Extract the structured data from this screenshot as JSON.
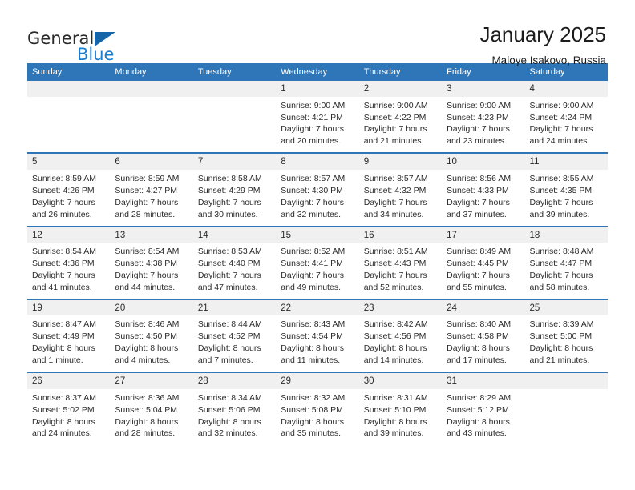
{
  "logo": {
    "word_top": "General",
    "word_bottom": "Blue",
    "triangle_color": "#1565a8",
    "blue_color": "#1b7fd0"
  },
  "header": {
    "month_title": "January 2025",
    "location": "Maloye Isakovo, Russia"
  },
  "theme": {
    "header_blue": "#2f76b8",
    "daynum_bg": "#f0f0f0",
    "text": "#2b2b2b"
  },
  "calendar": {
    "weekdays": [
      "Sunday",
      "Monday",
      "Tuesday",
      "Wednesday",
      "Thursday",
      "Friday",
      "Saturday"
    ],
    "weeks": [
      [
        {
          "day": "",
          "lines": []
        },
        {
          "day": "",
          "lines": []
        },
        {
          "day": "",
          "lines": []
        },
        {
          "day": "1",
          "lines": [
            "Sunrise: 9:00 AM",
            "Sunset: 4:21 PM",
            "Daylight: 7 hours",
            "and 20 minutes."
          ]
        },
        {
          "day": "2",
          "lines": [
            "Sunrise: 9:00 AM",
            "Sunset: 4:22 PM",
            "Daylight: 7 hours",
            "and 21 minutes."
          ]
        },
        {
          "day": "3",
          "lines": [
            "Sunrise: 9:00 AM",
            "Sunset: 4:23 PM",
            "Daylight: 7 hours",
            "and 23 minutes."
          ]
        },
        {
          "day": "4",
          "lines": [
            "Sunrise: 9:00 AM",
            "Sunset: 4:24 PM",
            "Daylight: 7 hours",
            "and 24 minutes."
          ]
        }
      ],
      [
        {
          "day": "5",
          "lines": [
            "Sunrise: 8:59 AM",
            "Sunset: 4:26 PM",
            "Daylight: 7 hours",
            "and 26 minutes."
          ]
        },
        {
          "day": "6",
          "lines": [
            "Sunrise: 8:59 AM",
            "Sunset: 4:27 PM",
            "Daylight: 7 hours",
            "and 28 minutes."
          ]
        },
        {
          "day": "7",
          "lines": [
            "Sunrise: 8:58 AM",
            "Sunset: 4:29 PM",
            "Daylight: 7 hours",
            "and 30 minutes."
          ]
        },
        {
          "day": "8",
          "lines": [
            "Sunrise: 8:57 AM",
            "Sunset: 4:30 PM",
            "Daylight: 7 hours",
            "and 32 minutes."
          ]
        },
        {
          "day": "9",
          "lines": [
            "Sunrise: 8:57 AM",
            "Sunset: 4:32 PM",
            "Daylight: 7 hours",
            "and 34 minutes."
          ]
        },
        {
          "day": "10",
          "lines": [
            "Sunrise: 8:56 AM",
            "Sunset: 4:33 PM",
            "Daylight: 7 hours",
            "and 37 minutes."
          ]
        },
        {
          "day": "11",
          "lines": [
            "Sunrise: 8:55 AM",
            "Sunset: 4:35 PM",
            "Daylight: 7 hours",
            "and 39 minutes."
          ]
        }
      ],
      [
        {
          "day": "12",
          "lines": [
            "Sunrise: 8:54 AM",
            "Sunset: 4:36 PM",
            "Daylight: 7 hours",
            "and 41 minutes."
          ]
        },
        {
          "day": "13",
          "lines": [
            "Sunrise: 8:54 AM",
            "Sunset: 4:38 PM",
            "Daylight: 7 hours",
            "and 44 minutes."
          ]
        },
        {
          "day": "14",
          "lines": [
            "Sunrise: 8:53 AM",
            "Sunset: 4:40 PM",
            "Daylight: 7 hours",
            "and 47 minutes."
          ]
        },
        {
          "day": "15",
          "lines": [
            "Sunrise: 8:52 AM",
            "Sunset: 4:41 PM",
            "Daylight: 7 hours",
            "and 49 minutes."
          ]
        },
        {
          "day": "16",
          "lines": [
            "Sunrise: 8:51 AM",
            "Sunset: 4:43 PM",
            "Daylight: 7 hours",
            "and 52 minutes."
          ]
        },
        {
          "day": "17",
          "lines": [
            "Sunrise: 8:49 AM",
            "Sunset: 4:45 PM",
            "Daylight: 7 hours",
            "and 55 minutes."
          ]
        },
        {
          "day": "18",
          "lines": [
            "Sunrise: 8:48 AM",
            "Sunset: 4:47 PM",
            "Daylight: 7 hours",
            "and 58 minutes."
          ]
        }
      ],
      [
        {
          "day": "19",
          "lines": [
            "Sunrise: 8:47 AM",
            "Sunset: 4:49 PM",
            "Daylight: 8 hours",
            "and 1 minute."
          ]
        },
        {
          "day": "20",
          "lines": [
            "Sunrise: 8:46 AM",
            "Sunset: 4:50 PM",
            "Daylight: 8 hours",
            "and 4 minutes."
          ]
        },
        {
          "day": "21",
          "lines": [
            "Sunrise: 8:44 AM",
            "Sunset: 4:52 PM",
            "Daylight: 8 hours",
            "and 7 minutes."
          ]
        },
        {
          "day": "22",
          "lines": [
            "Sunrise: 8:43 AM",
            "Sunset: 4:54 PM",
            "Daylight: 8 hours",
            "and 11 minutes."
          ]
        },
        {
          "day": "23",
          "lines": [
            "Sunrise: 8:42 AM",
            "Sunset: 4:56 PM",
            "Daylight: 8 hours",
            "and 14 minutes."
          ]
        },
        {
          "day": "24",
          "lines": [
            "Sunrise: 8:40 AM",
            "Sunset: 4:58 PM",
            "Daylight: 8 hours",
            "and 17 minutes."
          ]
        },
        {
          "day": "25",
          "lines": [
            "Sunrise: 8:39 AM",
            "Sunset: 5:00 PM",
            "Daylight: 8 hours",
            "and 21 minutes."
          ]
        }
      ],
      [
        {
          "day": "26",
          "lines": [
            "Sunrise: 8:37 AM",
            "Sunset: 5:02 PM",
            "Daylight: 8 hours",
            "and 24 minutes."
          ]
        },
        {
          "day": "27",
          "lines": [
            "Sunrise: 8:36 AM",
            "Sunset: 5:04 PM",
            "Daylight: 8 hours",
            "and 28 minutes."
          ]
        },
        {
          "day": "28",
          "lines": [
            "Sunrise: 8:34 AM",
            "Sunset: 5:06 PM",
            "Daylight: 8 hours",
            "and 32 minutes."
          ]
        },
        {
          "day": "29",
          "lines": [
            "Sunrise: 8:32 AM",
            "Sunset: 5:08 PM",
            "Daylight: 8 hours",
            "and 35 minutes."
          ]
        },
        {
          "day": "30",
          "lines": [
            "Sunrise: 8:31 AM",
            "Sunset: 5:10 PM",
            "Daylight: 8 hours",
            "and 39 minutes."
          ]
        },
        {
          "day": "31",
          "lines": [
            "Sunrise: 8:29 AM",
            "Sunset: 5:12 PM",
            "Daylight: 8 hours",
            "and 43 minutes."
          ]
        },
        {
          "day": "",
          "lines": []
        }
      ]
    ]
  }
}
